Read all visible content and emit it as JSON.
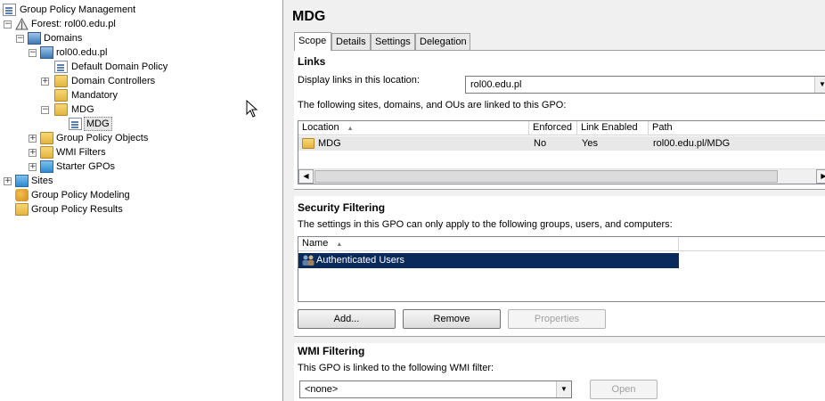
{
  "tree": {
    "items": [
      {
        "label": "Group Policy Management",
        "icon": "gpm-icon",
        "expander": ""
      },
      {
        "label": "Forest: rol00.edu.pl",
        "icon": "forest-icon",
        "expander": "−"
      },
      {
        "label": "Domains",
        "icon": "domains-icon",
        "expander": "−"
      },
      {
        "label": "rol00.edu.pl",
        "icon": "domain-icon",
        "expander": "−"
      },
      {
        "label": "Default Domain Policy",
        "icon": "gpo-link-icon",
        "expander": ""
      },
      {
        "label": "Domain Controllers",
        "icon": "ou-folder-icon",
        "expander": "+"
      },
      {
        "label": "Mandatory",
        "icon": "ou-folder-icon",
        "expander": ""
      },
      {
        "label": "MDG",
        "icon": "ou-folder-icon",
        "expander": "−"
      },
      {
        "label": "MDG",
        "icon": "gpo-link-icon",
        "expander": ""
      },
      {
        "label": "Group Policy Objects",
        "icon": "gpo-container-icon",
        "expander": "+"
      },
      {
        "label": "WMI Filters",
        "icon": "wmi-filter-icon",
        "expander": "+"
      },
      {
        "label": "Starter GPOs",
        "icon": "starter-gpo-icon",
        "expander": "+"
      },
      {
        "label": "Sites",
        "icon": "sites-icon",
        "expander": "+"
      },
      {
        "label": "Group Policy Modeling",
        "icon": "modeling-icon",
        "expander": ""
      },
      {
        "label": "Group Policy Results",
        "icon": "results-icon",
        "expander": ""
      }
    ]
  },
  "main": {
    "title": "MDG",
    "tabs": [
      "Scope",
      "Details",
      "Settings",
      "Delegation"
    ],
    "links": {
      "heading": "Links",
      "display_label": "Display links in this location:",
      "location_value": "rol00.edu.pl",
      "info": "The following sites, domains, and OUs are linked to this GPO:",
      "columns": [
        "Location",
        "Enforced",
        "Link Enabled",
        "Path"
      ],
      "sort_indicator": "▲",
      "rows": [
        {
          "location": "MDG",
          "enforced": "No",
          "link_enabled": "Yes",
          "path": "rol00.edu.pl/MDG"
        }
      ]
    },
    "security": {
      "heading": "Security Filtering",
      "info": "The settings in this GPO can only apply to the following groups, users, and computers:",
      "columns": [
        "Name"
      ],
      "rows": [
        "Authenticated Users"
      ],
      "buttons": {
        "add": "Add...",
        "remove": "Remove",
        "properties": "Properties"
      }
    },
    "wmi": {
      "heading": "WMI Filtering",
      "info": "This GPO is linked to the following WMI filter:",
      "value": "<none>",
      "open": "Open"
    }
  },
  "colors": {
    "selection": "#0b2a5c",
    "pane_bg": "#f0f0f0"
  }
}
